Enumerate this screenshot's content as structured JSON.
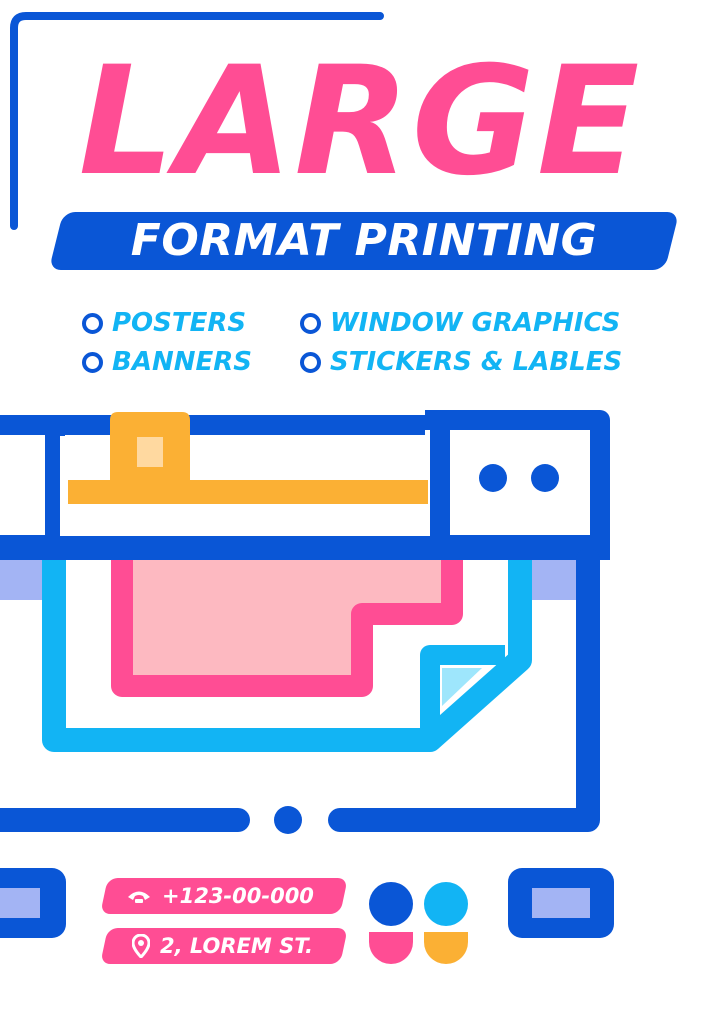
{
  "poster": {
    "title": "LARGE",
    "subtitle": "FORMAT PRINTING",
    "services": [
      {
        "label": "POSTERS"
      },
      {
        "label": "BANNERS"
      },
      {
        "label": "WINDOW GRAPHICS"
      },
      {
        "label": "STICKERS & LABLES"
      }
    ],
    "contact": {
      "phone": "+123-00-000",
      "address": "2, LOREM ST."
    }
  },
  "colors": {
    "pink": "#ff4d94",
    "blue": "#0a56d6",
    "cyan": "#12b4f4",
    "orange": "#fbb034",
    "light_pink": "#fdb9c1",
    "light_blue": "#a3b4f4"
  },
  "icons": {
    "phone": "phone-icon",
    "location": "location-pin-icon",
    "bullet": "circle-bullet-icon"
  }
}
